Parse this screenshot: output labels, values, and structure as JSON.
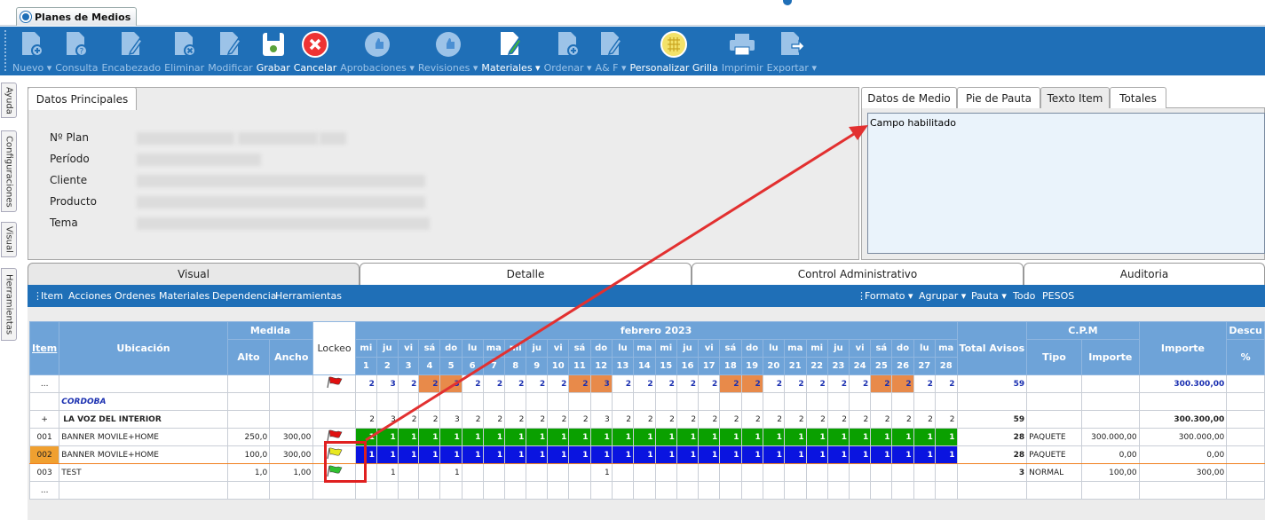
{
  "app_tab": {
    "title": "Planes de Medios"
  },
  "toolbar": [
    {
      "label": "Nuevo",
      "icon": "document-add-icon",
      "dropdown": true,
      "enabled": false
    },
    {
      "label": "Consulta",
      "icon": "document-help-icon",
      "dropdown": false,
      "enabled": false
    },
    {
      "label": "Encabezado",
      "icon": "document-edit-icon",
      "dropdown": false,
      "enabled": false
    },
    {
      "label": "Eliminar",
      "icon": "document-delete-icon",
      "dropdown": false,
      "enabled": false
    },
    {
      "label": "Modificar",
      "icon": "document-edit-icon",
      "dropdown": false,
      "enabled": false
    },
    {
      "label": "Grabar",
      "icon": "save-icon",
      "dropdown": false,
      "enabled": true
    },
    {
      "label": "Cancelar",
      "icon": "cancel-icon",
      "dropdown": false,
      "enabled": true
    },
    {
      "label": "Aprobaciones",
      "icon": "thumbs-up-icon",
      "dropdown": true,
      "enabled": false
    },
    {
      "label": "Revisiones",
      "icon": "thumbs-up-icon",
      "dropdown": true,
      "enabled": false
    },
    {
      "label": "Materiales",
      "icon": "document-pencil-icon",
      "dropdown": true,
      "enabled": true
    },
    {
      "label": "Ordenar",
      "icon": "document-add-icon",
      "dropdown": true,
      "enabled": false
    },
    {
      "label": "A& F",
      "icon": "document-edit-icon",
      "dropdown": true,
      "enabled": false
    },
    {
      "label": "Personalizar Grilla",
      "icon": "grid-icon",
      "dropdown": false,
      "enabled": true
    },
    {
      "label": "Imprimir",
      "icon": "printer-icon",
      "dropdown": false,
      "enabled": false
    },
    {
      "label": "Exportar",
      "icon": "export-icon",
      "dropdown": true,
      "enabled": false
    }
  ],
  "side_tabs": [
    "Ayuda",
    "Configuraciones",
    "Visual",
    "Herramientas"
  ],
  "datos_principales": {
    "tab": "Datos Principales",
    "fields": [
      "Nº Plan",
      "Período",
      "Cliente",
      "Producto",
      "Tema"
    ]
  },
  "right_tabs": [
    "Datos de Medio",
    "Pie de Pauta",
    "Texto Item",
    "Totales"
  ],
  "texto_item": "Campo habilitado",
  "main_tabs": [
    "Visual",
    "Detalle",
    "Control Administrativo",
    "Auditoria"
  ],
  "menu_left": [
    "Item",
    "Acciones",
    "Ordenes",
    "Materiales",
    "Dependencia",
    "Herramientas"
  ],
  "menu_right": [
    "Formato ▾",
    "Agrupar ▾",
    "Pauta ▾",
    "Todo",
    "PESOS"
  ],
  "grid": {
    "headers": {
      "item": "Item",
      "ubicacion": "Ubicación",
      "medida": "Medida",
      "alto": "Alto",
      "ancho": "Ancho",
      "lockeo": "Lockeo",
      "month": "febrero 2023",
      "total": "Total Avisos",
      "cpm": "C.P.M",
      "tipo": "Tipo",
      "importe_cpm": "Importe",
      "importe": "Importe",
      "descu": "Descu",
      "pct": "%"
    },
    "days": [
      "mi",
      "ju",
      "vi",
      "sá",
      "do",
      "lu",
      "ma",
      "mi",
      "ju",
      "vi",
      "sá",
      "do",
      "lu",
      "ma",
      "mi",
      "ju",
      "vi",
      "sá",
      "do",
      "lu",
      "ma",
      "mi",
      "ju",
      "vi",
      "sá",
      "do",
      "lu",
      "ma"
    ],
    "day_numbers": [
      "1",
      "2",
      "3",
      "4",
      "5",
      "6",
      "7",
      "8",
      "9",
      "10",
      "11",
      "12",
      "13",
      "14",
      "15",
      "16",
      "17",
      "18",
      "19",
      "20",
      "21",
      "22",
      "23",
      "24",
      "25",
      "26",
      "27",
      "28"
    ],
    "weekend_days": [
      4,
      5,
      11,
      12,
      18,
      19,
      25,
      26
    ],
    "rows": [
      {
        "item": "...",
        "ubicacion": "",
        "alto": "",
        "ancho": "",
        "flag": "red",
        "cells": [
          "2",
          "3",
          "2",
          "2",
          "3",
          "2",
          "2",
          "2",
          "2",
          "2",
          "2",
          "3",
          "2",
          "2",
          "2",
          "2",
          "2",
          "2",
          "2",
          "2",
          "2",
          "2",
          "2",
          "2",
          "2",
          "2",
          "2",
          "2"
        ],
        "style": "summary",
        "total": "59",
        "tipo": "",
        "importe_cpm": "",
        "importe": "300.300,00"
      },
      {
        "item": "",
        "ubicacion": "CORDOBA",
        "alto": "",
        "ancho": "",
        "flag": "",
        "cells": [],
        "style": "group",
        "total": "",
        "tipo": "",
        "importe_cpm": "",
        "importe": ""
      },
      {
        "item": "+",
        "ubicacion": "LA VOZ DEL INTERIOR",
        "alto": "",
        "ancho": "",
        "flag": "",
        "cells": [
          "2",
          "3",
          "2",
          "2",
          "3",
          "2",
          "2",
          "2",
          "2",
          "2",
          "2",
          "3",
          "2",
          "2",
          "2",
          "2",
          "2",
          "2",
          "2",
          "2",
          "2",
          "2",
          "2",
          "2",
          "2",
          "2",
          "2",
          "2"
        ],
        "style": "medio",
        "total": "59",
        "tipo": "",
        "importe_cpm": "",
        "importe": "300.300,00"
      },
      {
        "item": "001",
        "ubicacion": "BANNER MOVILE+HOME",
        "alto": "250,0",
        "ancho": "300,00",
        "flag": "red",
        "cells": [
          "1",
          "1",
          "1",
          "1",
          "1",
          "1",
          "1",
          "1",
          "1",
          "1",
          "1",
          "1",
          "1",
          "1",
          "1",
          "1",
          "1",
          "1",
          "1",
          "1",
          "1",
          "1",
          "1",
          "1",
          "1",
          "1",
          "1",
          "1"
        ],
        "style": "green",
        "total": "28",
        "tipo": "PAQUETE",
        "importe_cpm": "300.000,00",
        "importe": "300.000,00"
      },
      {
        "item": "002",
        "ubicacion": "BANNER MOVILE+HOME",
        "alto": "100,0",
        "ancho": "300,00",
        "flag": "yellow",
        "cells": [
          "1",
          "1",
          "1",
          "1",
          "1",
          "1",
          "1",
          "1",
          "1",
          "1",
          "1",
          "1",
          "1",
          "1",
          "1",
          "1",
          "1",
          "1",
          "1",
          "1",
          "1",
          "1",
          "1",
          "1",
          "1",
          "1",
          "1",
          "1"
        ],
        "style": "blue",
        "total": "28",
        "tipo": "PAQUETE",
        "importe_cpm": "0,00",
        "importe": "0,00"
      },
      {
        "item": "003",
        "ubicacion": "TEST",
        "alto": "1,0",
        "ancho": "1,00",
        "flag": "green",
        "cells": [
          "",
          "1",
          "",
          "",
          "1",
          "",
          "",
          "",
          "",
          "",
          "",
          "1",
          "",
          "",
          "",
          "",
          "",
          "",
          "",
          "",
          "",
          "",
          "",
          "",
          "",
          "",
          "",
          ""
        ],
        "style": "plain",
        "total": "3",
        "tipo": "NORMAL",
        "importe_cpm": "100,00",
        "importe": "300,00"
      },
      {
        "item": "...",
        "ubicacion": "",
        "alto": "",
        "ancho": "",
        "flag": "",
        "cells": [],
        "style": "empty",
        "total": "",
        "tipo": "",
        "importe_cpm": "",
        "importe": ""
      }
    ]
  }
}
